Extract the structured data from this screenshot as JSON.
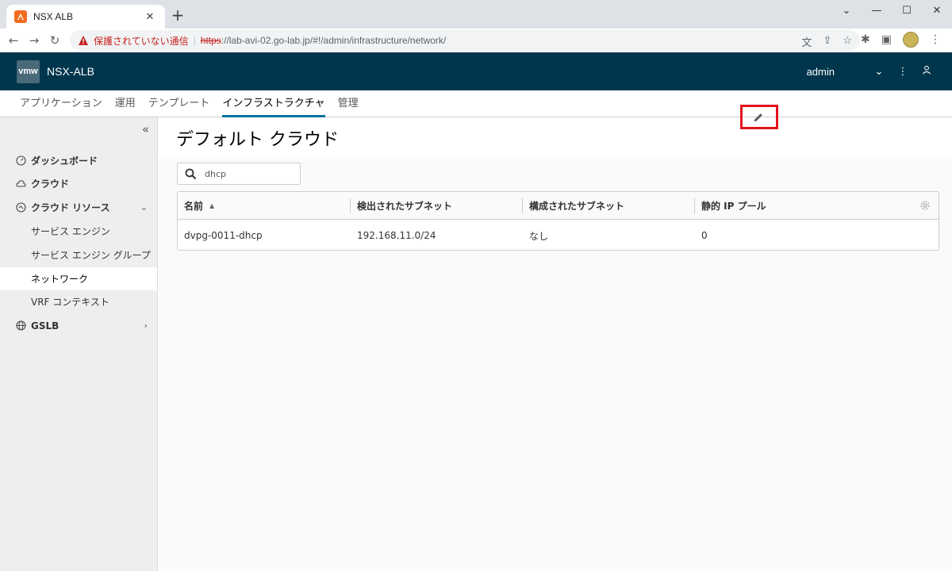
{
  "browser": {
    "tab_title": "NSX ALB",
    "tab_close": "✕",
    "new_tab": "+",
    "url_warning": "保護されていない通信",
    "url_scheme": "https",
    "url_rest": "://lab-avi-02.go-lab.jp/#!/admin/infrastructure/network/"
  },
  "header": {
    "logo": "vmw",
    "app_title": "NSX-ALB",
    "user": "admin"
  },
  "topnav": {
    "items": [
      "アプリケーション",
      "運用",
      "テンプレート",
      "インフラストラクチャ",
      "管理"
    ],
    "active_index": 3
  },
  "sidebar": {
    "collapse": "«",
    "dashboard": "ダッシュボード",
    "cloud": "クラウド",
    "cloud_resources": "クラウド リソース",
    "sub_items": [
      "サービス エンジン",
      "サービス エンジン グループ",
      "ネットワーク",
      "VRF コンテキスト"
    ],
    "active_sub_index": 2,
    "gslb": "GSLB"
  },
  "main": {
    "page_title": "デフォルト クラウド",
    "search_value": "dhcp",
    "columns": [
      "名前",
      "検出されたサブネット",
      "構成されたサブネット",
      "静的 IP プール"
    ],
    "rows": [
      {
        "name": "dvpg-0011-dhcp",
        "discovered": "192.168.11.0/24",
        "configured": "なし",
        "static_ip": "0"
      }
    ]
  },
  "colors": {
    "header_bg": "#00364d",
    "accent": "#0072a3",
    "highlight": "#e3131c"
  }
}
